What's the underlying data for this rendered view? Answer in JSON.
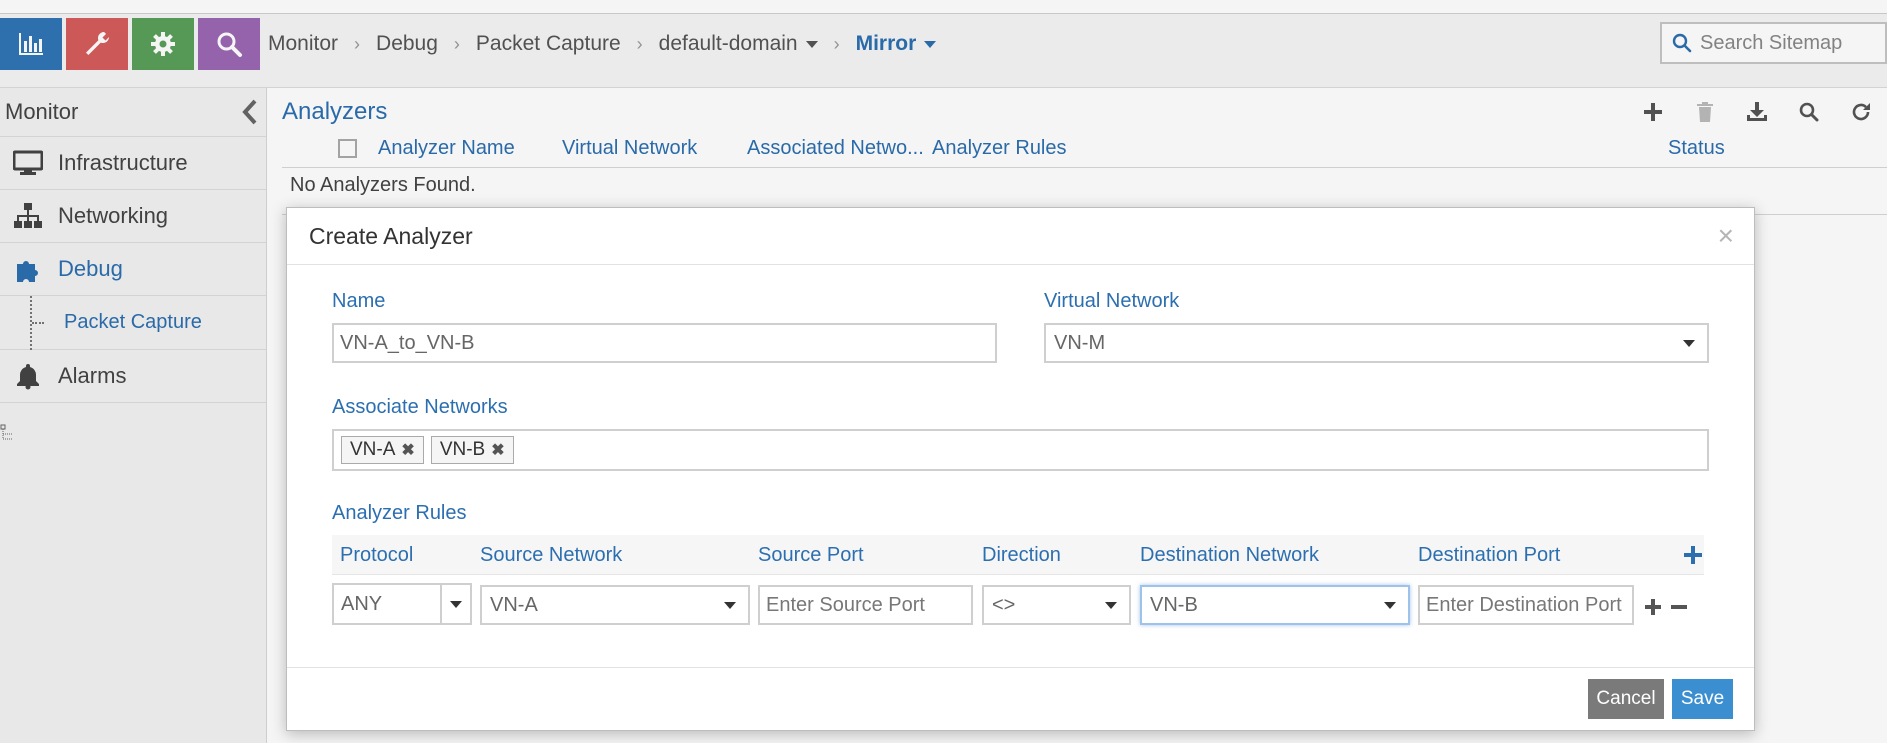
{
  "topbar": {
    "apps": [
      {
        "name": "monitor",
        "color": "#2f75b5",
        "icon": "bar-chart-icon"
      },
      {
        "name": "configure",
        "color": "#d65c5c",
        "icon": "wrench-icon"
      },
      {
        "name": "settings",
        "color": "#5aa05a",
        "icon": "gear-icon"
      },
      {
        "name": "query",
        "color": "#9b68b3",
        "icon": "search-icon"
      }
    ],
    "breadcrumb": [
      "Monitor",
      "Debug",
      "Packet Capture",
      "default-domain",
      "Mirror"
    ],
    "search_placeholder": "Search Sitemap"
  },
  "sidebar": {
    "title": "Monitor",
    "items": [
      {
        "label": "Infrastructure",
        "icon": "monitor-icon"
      },
      {
        "label": "Networking",
        "icon": "network-tree-icon"
      },
      {
        "label": "Debug",
        "icon": "puzzle-icon"
      },
      {
        "label": "Alarms",
        "icon": "bell-icon"
      }
    ],
    "sub_item": "Packet Capture"
  },
  "main": {
    "title": "Analyzers",
    "tools": [
      "add-icon",
      "delete-icon",
      "download-icon",
      "search-icon",
      "refresh-icon"
    ],
    "columns": [
      "Analyzer Name",
      "Virtual Network",
      "Associated Netwo...",
      "Analyzer Rules",
      "Status"
    ],
    "empty_text": "No Analyzers Found."
  },
  "modal": {
    "title": "Create Analyzer",
    "close": "×",
    "name_label": "Name",
    "name_value": "VN-A_to_VN-B",
    "vn_label": "Virtual Network",
    "vn_value": "VN-M",
    "assoc_label": "Associate Networks",
    "assoc_tags": [
      "VN-A",
      "VN-B"
    ],
    "rules_label": "Analyzer Rules",
    "rule_columns": [
      "Protocol",
      "Source Network",
      "Source Port",
      "Direction",
      "Destination Network",
      "Destination Port"
    ],
    "rule": {
      "protocol": "ANY",
      "source_network": "VN-A",
      "source_port_placeholder": "Enter Source Port",
      "direction": "<>",
      "destination_network": "VN-B",
      "destination_port_placeholder": "Enter Destination Port"
    },
    "cancel_label": "Cancel",
    "save_label": "Save"
  },
  "colors": {
    "accent": "#2c6fb0",
    "save": "#3b8fd1",
    "cancel": "#7a7a7a"
  }
}
